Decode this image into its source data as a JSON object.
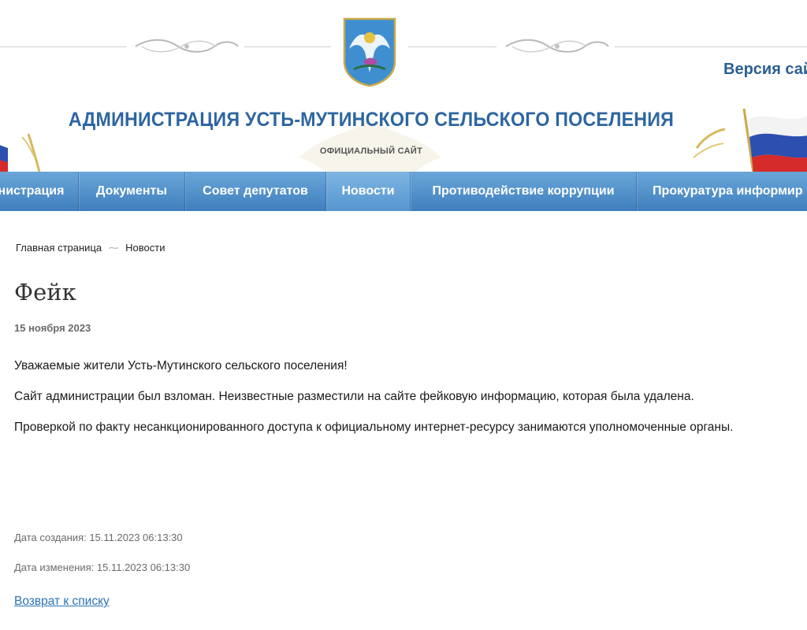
{
  "header": {
    "title": "АДМИНИСТРАЦИЯ УСТЬ-МУТИНСКОГО СЕЛЬСКОГО ПОСЕЛЕНИЯ",
    "subtitle": "ОФИЦИАЛЬНЫЙ САЙТ",
    "version_link": "Версия сай"
  },
  "nav": {
    "items": [
      {
        "label": "нистрация"
      },
      {
        "label": "Документы"
      },
      {
        "label": "Совет депутатов"
      },
      {
        "label": "Новости",
        "active": true
      },
      {
        "label": "Противодействие коррупции"
      },
      {
        "label": "Прокуратура информир"
      }
    ]
  },
  "breadcrumb": {
    "home": "Главная страница",
    "current": "Новости"
  },
  "article": {
    "title": "Фейк",
    "date": "15 ноября 2023",
    "paragraphs": [
      "Уважаемые жители Усть-Мутинского сельского поселения!",
      "Сайт администрации был взломан. Неизвестные разместили на сайте фейковую информацию, которая была удалена.",
      "Проверкой по факту несанкционированного доступа к официальному интернет-ресурсу занимаются уполномоченные органы."
    ],
    "created": "Дата создания: 15.11.2023 06:13:30",
    "modified": "Дата изменения: 15.11.2023 06:13:30",
    "back_link": "Возврат к списку"
  },
  "colors": {
    "title_blue": "#2d66a0",
    "nav_blue": "#4a8ac6",
    "link_blue": "#2a72b5"
  }
}
